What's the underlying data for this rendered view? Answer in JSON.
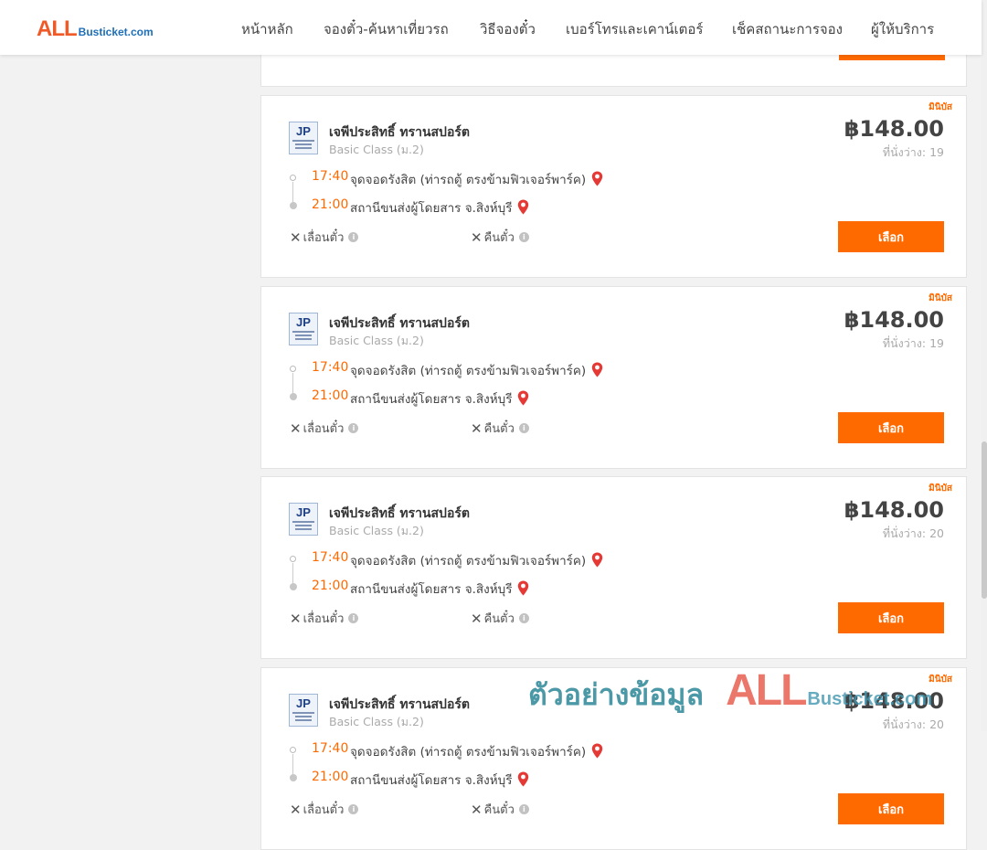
{
  "header": {
    "logo_all": "ALL",
    "logo_rest": "Busticket.com",
    "nav": [
      "หน้าหลัก",
      "จองตั๋ว-ค้นหาเที่ยวรถ",
      "วิธีจองตั๋ว",
      "เบอร์โทรและเคาน์เตอร์",
      "เช็คสถานะการจอง",
      "ผู้ให้บริการ"
    ]
  },
  "trips": [
    {
      "badge": "มินิบัส",
      "logo_text": "JP",
      "operator": "เจพีประสิทธิ์ ทรานสปอร์ต",
      "bus_class": "Basic Class (ม.2)",
      "price": "฿148.00",
      "seats": "ที่นั่งว่าง: 19",
      "depart_time": "17:40",
      "depart_place": "จุดจอดรังสิต (ท่ารถตู้ ตรงข้ามฟิวเจอร์พาร์ค)",
      "arrive_time": "21:00",
      "arrive_place": "สถานีขนส่งผู้โดยสาร จ.สิงห์บุรี",
      "reschedule": "เลื่อนตั๋ว",
      "refund": "คืนตั๋ว",
      "select": "เลือก"
    },
    {
      "badge": "มินิบัส",
      "logo_text": "JP",
      "operator": "เจพีประสิทธิ์ ทรานสปอร์ต",
      "bus_class": "Basic Class (ม.2)",
      "price": "฿148.00",
      "seats": "ที่นั่งว่าง: 19",
      "depart_time": "17:40",
      "depart_place": "จุดจอดรังสิต (ท่ารถตู้ ตรงข้ามฟิวเจอร์พาร์ค)",
      "arrive_time": "21:00",
      "arrive_place": "สถานีขนส่งผู้โดยสาร จ.สิงห์บุรี",
      "reschedule": "เลื่อนตั๋ว",
      "refund": "คืนตั๋ว",
      "select": "เลือก"
    },
    {
      "badge": "มินิบัส",
      "logo_text": "JP",
      "operator": "เจพีประสิทธิ์ ทรานสปอร์ต",
      "bus_class": "Basic Class (ม.2)",
      "price": "฿148.00",
      "seats": "ที่นั่งว่าง: 20",
      "depart_time": "17:40",
      "depart_place": "จุดจอดรังสิต (ท่ารถตู้ ตรงข้ามฟิวเจอร์พาร์ค)",
      "arrive_time": "21:00",
      "arrive_place": "สถานีขนส่งผู้โดยสาร จ.สิงห์บุรี",
      "reschedule": "เลื่อนตั๋ว",
      "refund": "คืนตั๋ว",
      "select": "เลือก"
    },
    {
      "badge": "มินิบัส",
      "logo_text": "JP",
      "operator": "เจพีประสิทธิ์ ทรานสปอร์ต",
      "bus_class": "Basic Class (ม.2)",
      "price": "฿148.00",
      "seats": "ที่นั่งว่าง: 20",
      "depart_time": "17:40",
      "depart_place": "จุดจอดรังสิต (ท่ารถตู้ ตรงข้ามฟิวเจอร์พาร์ค)",
      "arrive_time": "21:00",
      "arrive_place": "สถานีขนส่งผู้โดยสาร จ.สิงห์บุรี",
      "reschedule": "เลื่อนตั๋ว",
      "refund": "คืนตั๋ว",
      "select": "เลือก"
    }
  ],
  "watermark": {
    "thai": "ตัวอย่างข้อมูล",
    "all": "ALL",
    "rest": "Busticket.com"
  },
  "colors": {
    "accent": "#ff6a00",
    "brand_red": "#f05a28",
    "brand_blue": "#1e6fb7",
    "pin_red": "#e53935"
  }
}
